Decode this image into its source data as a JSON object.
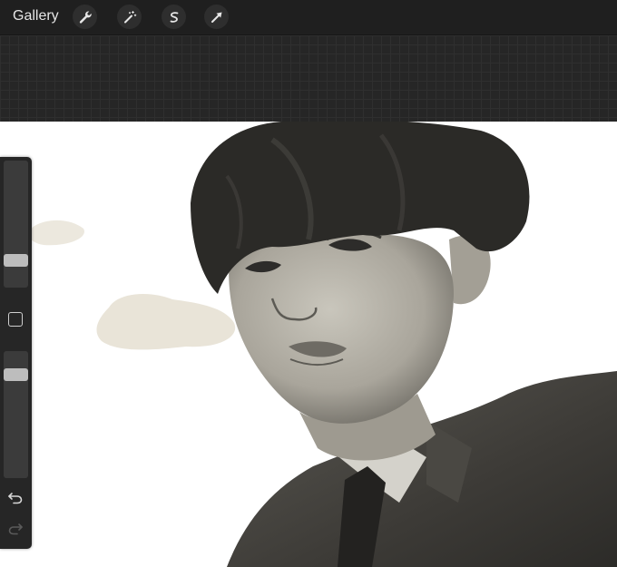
{
  "toolbar": {
    "gallery_label": "Gallery",
    "tools": [
      {
        "icon": "wrench-icon",
        "name": "actions"
      },
      {
        "icon": "magic-wand-icon",
        "name": "adjustments"
      },
      {
        "icon": "selection-s-icon",
        "name": "selection"
      },
      {
        "icon": "arrow-cursor-icon",
        "name": "transform"
      }
    ]
  },
  "sidebar": {
    "brush_size_level": 0.18,
    "opacity_level": 0.85,
    "undo_icon": "undo-icon",
    "redo_icon": "redo-icon"
  },
  "colors": {
    "toolbar_bg": "#1f1f1f",
    "grid_bg": "#262626",
    "sidebar_bg": "#262626",
    "canvas_bg": "#ffffff"
  }
}
